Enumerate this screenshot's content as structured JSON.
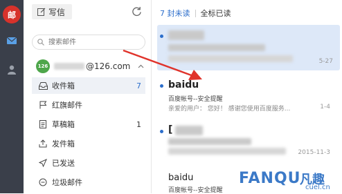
{
  "app": {
    "logo_text": "邮"
  },
  "rail": {
    "icons": [
      "mail-icon",
      "contacts-icon"
    ]
  },
  "toolbar": {
    "compose_label": "写信",
    "unread_count": "7 封未读",
    "mark_all_read": "全标已读"
  },
  "search": {
    "placeholder": "搜索邮件"
  },
  "account": {
    "badge": "126",
    "email_suffix": "@126.com"
  },
  "folders": [
    {
      "label": "收件箱",
      "count": "7",
      "icon": "inbox-icon"
    },
    {
      "label": "红旗邮件",
      "count": "",
      "icon": "flag-icon"
    },
    {
      "label": "草稿箱",
      "count": "1",
      "icon": "draft-icon"
    },
    {
      "label": "发件箱",
      "count": "",
      "icon": "outbox-icon"
    },
    {
      "label": "已发送",
      "count": "",
      "icon": "sent-icon"
    },
    {
      "label": "垃圾邮件",
      "count": "",
      "icon": "spam-icon"
    }
  ],
  "messages": [
    {
      "sender": "",
      "subject": "",
      "snippet": "",
      "date": "5-27",
      "unread": true
    },
    {
      "sender": "baidu",
      "subject": "百度帐号--安全提醒",
      "snippet": "亲爱的用户： 您好！ 感谢您使用百度服务...",
      "date": "1-4",
      "unread": true
    },
    {
      "sender": "[",
      "subject": "",
      "snippet": "",
      "date": "2015-11-3",
      "unread": true
    },
    {
      "sender": "baidu",
      "subject": "百度帐号--安全提醒",
      "snippet": "",
      "date": "",
      "unread": false
    }
  ],
  "watermark": {
    "main": "FANQU",
    "cn": "凡趣",
    "url": "cuel.cn"
  },
  "colors": {
    "rail_bg": "#3a3f4a",
    "logo_red": "#d7322b",
    "accent_blue": "#2c6ecb",
    "selected_item_bg": "#dde8f8",
    "arrow_red": "#e0332b"
  }
}
